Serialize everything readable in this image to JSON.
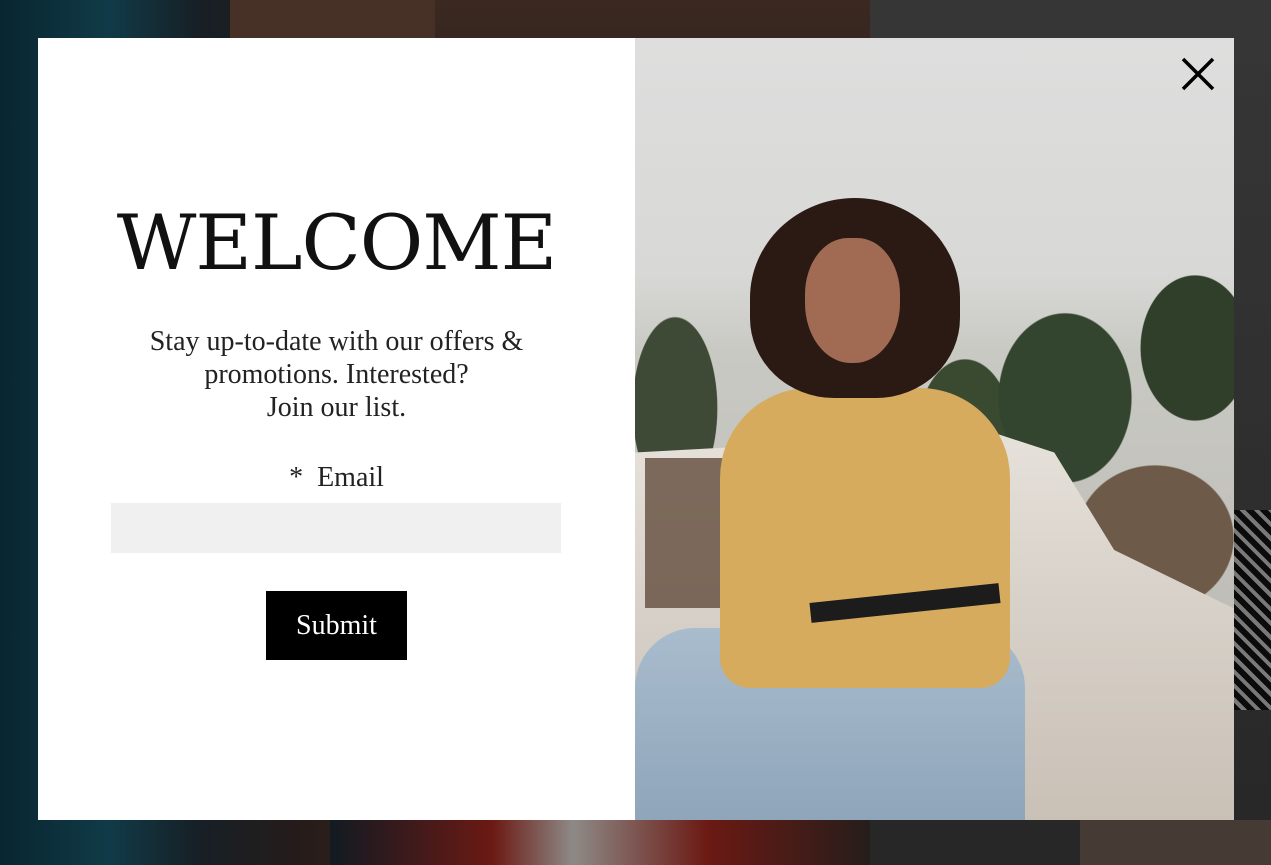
{
  "popup": {
    "title": "WELCOME",
    "subtitle_lines": [
      "Stay up-to-date with our offers &",
      "promotions. Interested?",
      "Join our list."
    ],
    "email_field": {
      "required_marker": "*",
      "label": "Email",
      "value": "",
      "placeholder": ""
    },
    "submit_label": "Submit",
    "close_icon": "close-icon"
  },
  "colors": {
    "button_bg": "#000000",
    "input_bg": "#f0f0f0",
    "modal_bg": "#ffffff"
  }
}
